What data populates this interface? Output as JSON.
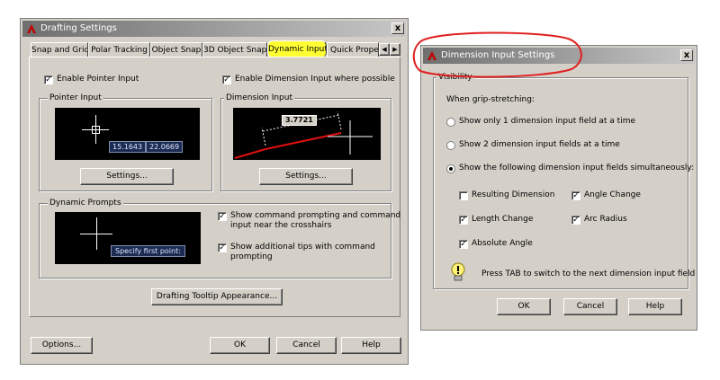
{
  "drafting": {
    "title": "Drafting Settings",
    "close": "x",
    "tabs": [
      "Snap and Grid",
      "Polar Tracking",
      "Object Snap",
      "3D Object Snap",
      "Dynamic Input",
      "Quick Propert"
    ],
    "scroll_left": "◀",
    "scroll_right": "▶",
    "enable_pointer": {
      "label": "Enable Pointer Input",
      "checked": true
    },
    "enable_dimension": {
      "label": "Enable Dimension Input where possible",
      "checked": true
    },
    "pointer_group": "Pointer Input",
    "pointer_coord_x": "15.1643",
    "pointer_coord_y": "22.0669",
    "pointer_settings": "Settings...",
    "dimension_group": "Dimension Input",
    "dimension_value": "3.7721",
    "dimension_settings": "Settings...",
    "prompts_group": "Dynamic Prompts",
    "prompt_text": "Specify first point:",
    "show_command_prompting": {
      "label_line1": "Show command prompting and command",
      "label_line2": "input near the crosshairs",
      "checked": true
    },
    "show_additional_tips": {
      "label_line1": "Show additional tips with command",
      "label_line2": "prompting",
      "checked": true
    },
    "tooltip_appearance": "Drafting Tooltip Appearance...",
    "options": "Options...",
    "ok": "OK",
    "cancel": "Cancel",
    "help": "Help"
  },
  "dimension_settings": {
    "title": "Dimension Input Settings",
    "close": "x",
    "visibility_group": "Visibility",
    "grip_label": "When grip-stretching:",
    "radio1": {
      "label": "Show only 1 dimension input field at a time",
      "selected": false
    },
    "radio2": {
      "label": "Show 2 dimension input fields at a time",
      "selected": false
    },
    "radio3": {
      "label": "Show the following dimension input fields simultaneously:",
      "selected": true
    },
    "resulting_dimension": {
      "label": "Resulting Dimension",
      "checked": false
    },
    "angle_change": {
      "label": "Angle Change",
      "checked": true
    },
    "length_change": {
      "label": "Length Change",
      "checked": true
    },
    "arc_radius": {
      "label": "Arc Radius",
      "checked": true
    },
    "absolute_angle": {
      "label": "Absolute Angle",
      "checked": true
    },
    "tip_icon": "lightbulb-icon",
    "tip": "Press TAB to switch to the next dimension input field",
    "ok": "OK",
    "cancel": "Cancel",
    "help": "Help"
  },
  "colors": {
    "dialog_bg": "#d4d0c8",
    "title_active": "#0a246a",
    "title_inactive": "#6f6f6f",
    "highlight_yellow": "#ffff33",
    "annotation_red": "#e02020",
    "preview_bg": "#000000",
    "dimension_line_red": "#e01010"
  }
}
